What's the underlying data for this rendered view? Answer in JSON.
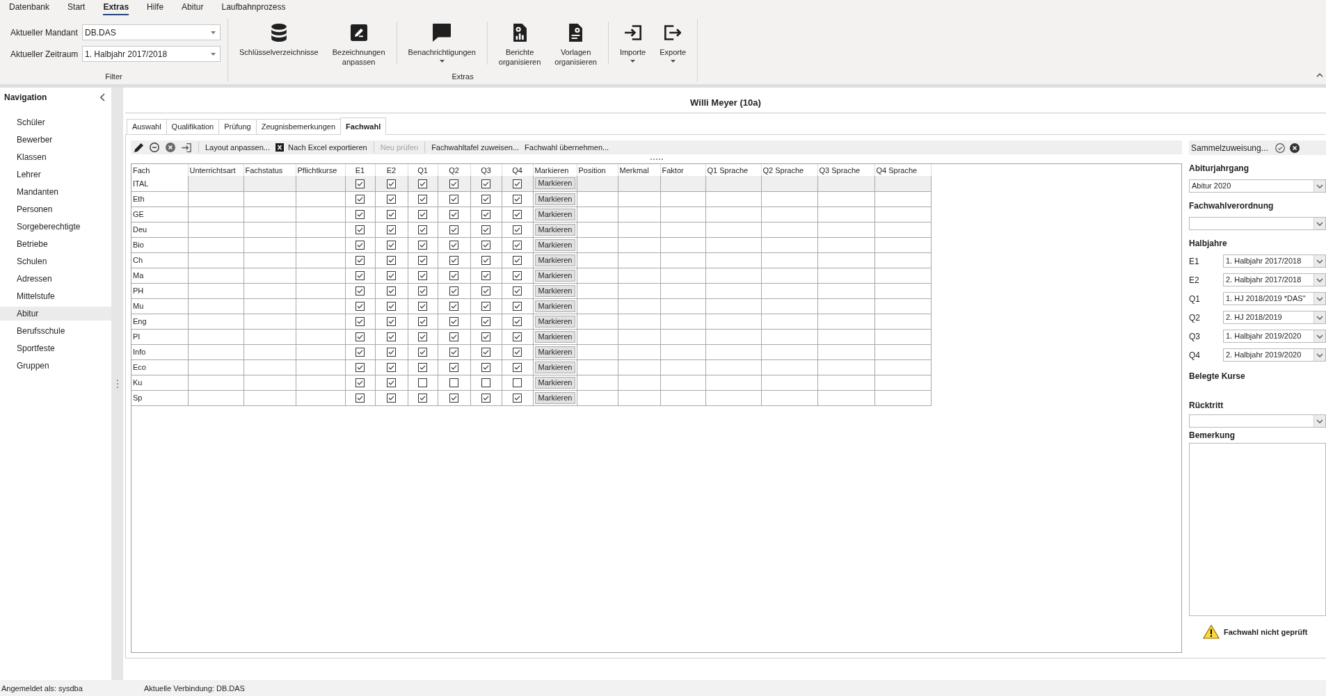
{
  "menu_tabs": [
    {
      "label": "Datenbank",
      "selected": false
    },
    {
      "label": "Start",
      "selected": false
    },
    {
      "label": "Extras",
      "selected": true
    },
    {
      "label": "Hilfe",
      "selected": false
    },
    {
      "label": "Abitur",
      "selected": false
    },
    {
      "label": "Laufbahnprozess",
      "selected": false
    }
  ],
  "ribbon": {
    "filter_group": {
      "label": "Filter",
      "fields": [
        {
          "label": "Aktueller Mandant",
          "value": "DB.DAS"
        },
        {
          "label": "Aktueller Zeitraum",
          "value": "1. Halbjahr 2017/2018"
        }
      ]
    },
    "extras_group": {
      "label": "Extras",
      "sections": [
        {
          "buttons": [
            {
              "label": "Schlüsselverzeichnisse",
              "dropdown": false
            },
            {
              "label": "Bezeichnungen anpassen",
              "dropdown": false
            }
          ]
        },
        {
          "buttons": [
            {
              "label": "Benachrichtigungen",
              "dropdown": true
            }
          ]
        },
        {
          "buttons": [
            {
              "label": "Berichte organisieren",
              "dropdown": false
            },
            {
              "label": "Vorlagen organisieren",
              "dropdown": false
            }
          ]
        },
        {
          "buttons": [
            {
              "label": "Importe",
              "dropdown": true
            },
            {
              "label": "Exporte",
              "dropdown": true
            }
          ]
        }
      ]
    }
  },
  "navigation": {
    "title": "Navigation",
    "items": [
      {
        "label": "Schüler",
        "selected": false
      },
      {
        "label": "Bewerber",
        "selected": false
      },
      {
        "label": "Klassen",
        "selected": false
      },
      {
        "label": "Lehrer",
        "selected": false
      },
      {
        "label": "Mandanten",
        "selected": false
      },
      {
        "label": "Personen",
        "selected": false
      },
      {
        "label": "Sorgeberechtigte",
        "selected": false
      },
      {
        "label": "Betriebe",
        "selected": false
      },
      {
        "label": "Schulen",
        "selected": false
      },
      {
        "label": "Adressen",
        "selected": false
      },
      {
        "label": "Mittelstufe",
        "selected": false
      },
      {
        "label": "Abitur",
        "selected": true
      },
      {
        "label": "Berufsschule",
        "selected": false
      },
      {
        "label": "Sportfeste",
        "selected": false
      },
      {
        "label": "Gruppen",
        "selected": false
      }
    ]
  },
  "record_title": "Willi Meyer (10a)",
  "tabs": [
    {
      "label": "Auswahl",
      "selected": false
    },
    {
      "label": "Qualifikation",
      "selected": false
    },
    {
      "label": "Prüfung",
      "selected": false
    },
    {
      "label": "Zeugnisbemerkungen",
      "selected": false
    },
    {
      "label": "Fachwahl",
      "selected": true
    }
  ],
  "toolbar": {
    "groups": [
      {
        "buttons": [
          {
            "label": "Layout anpassen...",
            "disabled": false
          },
          {
            "label": "Nach Excel exportieren",
            "disabled": false
          }
        ]
      },
      {
        "buttons": [
          {
            "label": "Neu prüfen",
            "disabled": true
          }
        ]
      },
      {
        "buttons": [
          {
            "label": "Fachwahltafel zuweisen...",
            "disabled": false
          },
          {
            "label": "Fachwahl übernehmen...",
            "disabled": false
          }
        ]
      }
    ]
  },
  "grid": {
    "columns": [
      {
        "label": "Fach",
        "kind": "name"
      },
      {
        "label": "Unterrichtsart",
        "kind": "text"
      },
      {
        "label": "Fachstatus",
        "kind": "text"
      },
      {
        "label": "Pflichtkurse",
        "kind": "text"
      },
      {
        "label": "E1",
        "kind": "check"
      },
      {
        "label": "E2",
        "kind": "check"
      },
      {
        "label": "Q1",
        "kind": "check"
      },
      {
        "label": "Q2",
        "kind": "check"
      },
      {
        "label": "Q3",
        "kind": "check"
      },
      {
        "label": "Q4",
        "kind": "check"
      },
      {
        "label": "Markieren",
        "kind": "button"
      },
      {
        "label": "Position",
        "kind": "text"
      },
      {
        "label": "Merkmal",
        "kind": "text"
      },
      {
        "label": "Faktor",
        "kind": "text"
      },
      {
        "label": "Q1 Sprache",
        "kind": "text"
      },
      {
        "label": "Q2 Sprache",
        "kind": "text"
      },
      {
        "label": "Q3 Sprache",
        "kind": "text"
      },
      {
        "label": "Q4 Sprache",
        "kind": "text"
      }
    ],
    "rows": [
      {
        "fach": "ITAL",
        "selected": true,
        "checks": [
          true,
          true,
          true,
          true,
          true,
          true
        ],
        "button": "Markieren"
      },
      {
        "fach": "Eth",
        "selected": false,
        "checks": [
          true,
          true,
          true,
          true,
          true,
          true
        ],
        "button": "Markieren"
      },
      {
        "fach": "GE",
        "selected": false,
        "checks": [
          true,
          true,
          true,
          true,
          true,
          true
        ],
        "button": "Markieren"
      },
      {
        "fach": "Deu",
        "selected": false,
        "checks": [
          true,
          true,
          true,
          true,
          true,
          true
        ],
        "button": "Markieren"
      },
      {
        "fach": "Bio",
        "selected": false,
        "checks": [
          true,
          true,
          true,
          true,
          true,
          true
        ],
        "button": "Markieren"
      },
      {
        "fach": "Ch",
        "selected": false,
        "checks": [
          true,
          true,
          true,
          true,
          true,
          true
        ],
        "button": "Markieren"
      },
      {
        "fach": "Ma",
        "selected": false,
        "checks": [
          true,
          true,
          true,
          true,
          true,
          true
        ],
        "button": "Markieren"
      },
      {
        "fach": "PH",
        "selected": false,
        "checks": [
          true,
          true,
          true,
          true,
          true,
          true
        ],
        "button": "Markieren"
      },
      {
        "fach": "Mu",
        "selected": false,
        "checks": [
          true,
          true,
          true,
          true,
          true,
          true
        ],
        "button": "Markieren"
      },
      {
        "fach": "Eng",
        "selected": false,
        "checks": [
          true,
          true,
          true,
          true,
          true,
          true
        ],
        "button": "Markieren"
      },
      {
        "fach": "PI",
        "selected": false,
        "checks": [
          true,
          true,
          true,
          true,
          true,
          true
        ],
        "button": "Markieren"
      },
      {
        "fach": "Info",
        "selected": false,
        "checks": [
          true,
          true,
          true,
          true,
          true,
          true
        ],
        "button": "Markieren"
      },
      {
        "fach": "Eco",
        "selected": false,
        "checks": [
          true,
          true,
          true,
          true,
          true,
          true
        ],
        "button": "Markieren"
      },
      {
        "fach": "Ku",
        "selected": false,
        "checks": [
          true,
          true,
          false,
          false,
          false,
          false
        ],
        "button": "Markieren"
      },
      {
        "fach": "Sp",
        "selected": false,
        "checks": [
          true,
          true,
          true,
          true,
          true,
          true
        ],
        "button": "Markieren"
      }
    ]
  },
  "side_panel": {
    "assign_button": "Sammelzuweisung...",
    "abiturjahrgang": {
      "label": "Abiturjahrgang",
      "value": "Abitur 2020"
    },
    "fachwahlverordnung": {
      "label": "Fachwahlverordnung"
    },
    "halbjahre": {
      "label": "Halbjahre",
      "rows": [
        {
          "label": "E1",
          "value": "1. Halbjahr 2017/2018"
        },
        {
          "label": "E2",
          "value": "2. Halbjahr 2017/2018"
        },
        {
          "label": "Q1",
          "value": "1. HJ 2018/2019 *DAS\""
        },
        {
          "label": "Q2",
          "value": "2. HJ 2018/2019"
        },
        {
          "label": "Q3",
          "value": "1. Halbjahr 2019/2020"
        },
        {
          "label": "Q4",
          "value": "2. Halbjahr 2019/2020"
        }
      ]
    },
    "belegte_kurse": {
      "label": "Belegte Kurse"
    },
    "ruecktritt": {
      "label": "Rücktritt"
    },
    "bemerkung": {
      "label": "Bemerkung"
    },
    "status": "Fachwahl nicht geprüft"
  },
  "status_bar": {
    "user": "Angemeldet als: sysdba",
    "connection": "Aktuelle Verbindung: DB.DAS"
  }
}
